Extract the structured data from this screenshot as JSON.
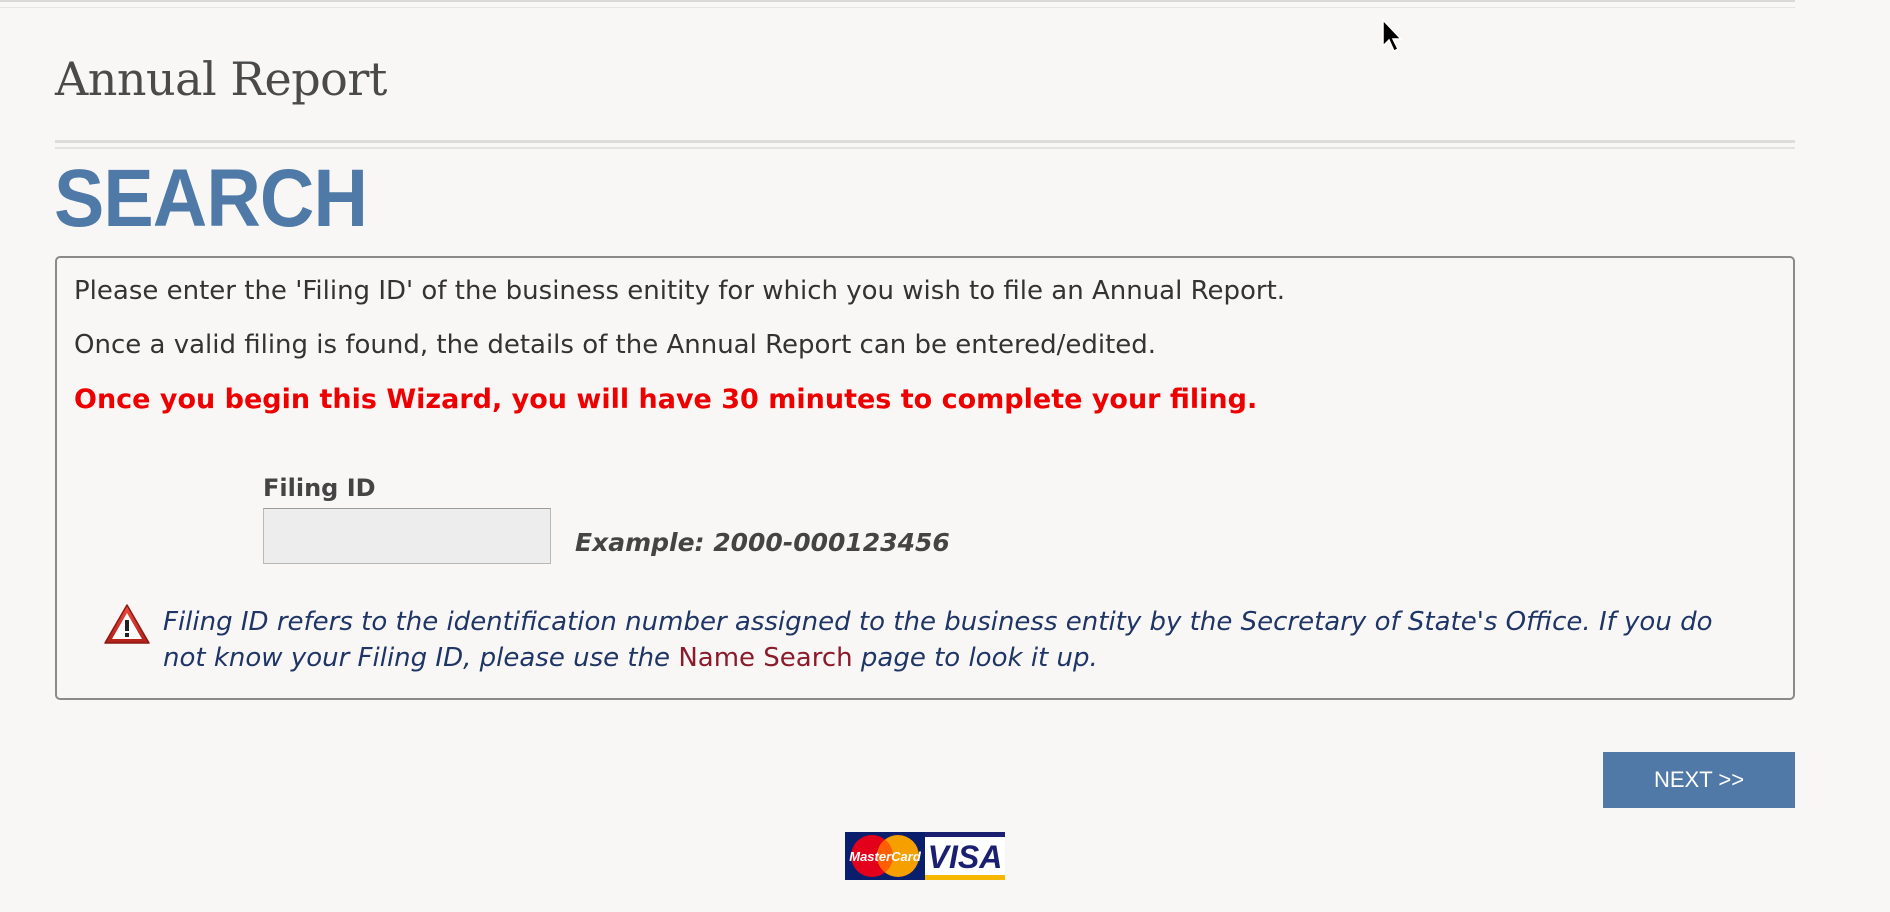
{
  "header": {
    "title": "Annual Report"
  },
  "section": {
    "heading": "SEARCH"
  },
  "panel": {
    "intro_line_1": "Please enter the 'Filing ID' of the business enitity for which you wish to file an Annual Report.",
    "intro_line_2": "Once a valid filing is found, the details of the Annual Report can be entered/edited.",
    "warning": "Once you begin this Wizard, you will have 30 minutes to complete your filing."
  },
  "form": {
    "filing_id_label": "Filing ID",
    "filing_id_value": "",
    "example": "Example: 2000-000123456"
  },
  "info": {
    "text_before_link": "Filing ID refers to the identification number assigned to the business entity by the Secretary of State's Office. If you do not know your Filing ID, please use the ",
    "link_label": "Name Search",
    "text_after_link": " page to look it up."
  },
  "actions": {
    "next_label": "NEXT >>"
  },
  "payment": {
    "mastercard_label": "MasterCard",
    "visa_label": "VISA"
  },
  "colors": {
    "heading_blue": "#4f7aa7",
    "warning_red": "#ee0000",
    "info_navy": "#1f3566",
    "link_maroon": "#8b1a2b",
    "button_blue": "#5079a8"
  },
  "icons": {
    "alert": "warning-triangle-icon",
    "cursor": "mouse-pointer-icon"
  }
}
